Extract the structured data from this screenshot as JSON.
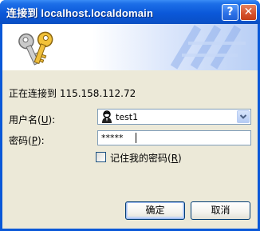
{
  "window": {
    "title": "连接到 localhost.localdomain",
    "help_glyph": "?",
    "close_glyph": "✕"
  },
  "dialog": {
    "connecting_text": "正在连接到 115.158.112.72",
    "username_label": "用户名",
    "username_hotkey": "U",
    "username_value": "test1",
    "password_label": "密码",
    "password_hotkey": "P",
    "password_value": "*****",
    "remember_label": "记住我的密码",
    "remember_hotkey": "R",
    "remember_checked": false,
    "ok_label": "确定",
    "cancel_label": "取消"
  },
  "colors": {
    "titlebar_blue": "#0a58d8",
    "dialog_bg": "#ece9d8",
    "close_red": "#d5502b"
  },
  "icons": {
    "banner": "keys-icon",
    "user": "user-icon",
    "dropdown": "chevron-down-icon"
  }
}
